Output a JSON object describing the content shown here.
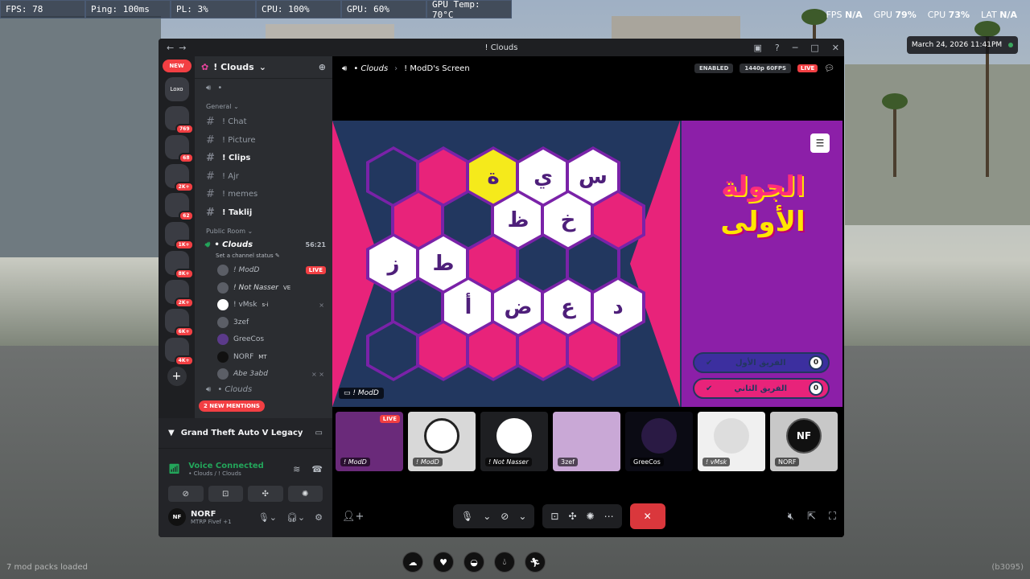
{
  "perf": [
    {
      "label": "FPS: 78"
    },
    {
      "label": "Ping: 100ms"
    },
    {
      "label": "PL: 3%"
    },
    {
      "label": "CPU: 100%"
    },
    {
      "label": "GPU: 60%"
    },
    {
      "label": "GPU Temp: 70°C"
    }
  ],
  "hud": {
    "fps_label": "FPS",
    "fps_value": "N/A",
    "gpu_label": "GPU",
    "gpu_value": "79",
    "cpu_label": "CPU",
    "cpu_value": "73",
    "lat_label": "LAT",
    "lat_value": "N/A",
    "clock": "March 24, 2026 11:41PM"
  },
  "window": {
    "title": "! Clouds"
  },
  "rail": {
    "new_label": "NEW",
    "servers": [
      {
        "label": "Loxo",
        "badge": ""
      },
      {
        "label": "",
        "badge": "769"
      },
      {
        "label": "",
        "badge": "68"
      },
      {
        "label": "",
        "badge": "2K+"
      },
      {
        "label": "",
        "badge": "62"
      },
      {
        "label": "",
        "badge": "1K+"
      },
      {
        "label": "",
        "badge": "8K+"
      },
      {
        "label": "",
        "badge": "2K+"
      },
      {
        "label": "",
        "badge": "6K+"
      },
      {
        "label": "",
        "badge": "4K+"
      }
    ]
  },
  "guild": {
    "name": "! Clouds",
    "top_channel": "•",
    "categories": {
      "general": "General",
      "public": "Public Room"
    },
    "text_channels": [
      {
        "name": "! Chat",
        "bright": false
      },
      {
        "name": "! Picture",
        "bright": false
      },
      {
        "name": "! Clips",
        "bright": true
      },
      {
        "name": "! Ajr",
        "bright": false
      },
      {
        "name": "! memes",
        "bright": false
      },
      {
        "name": "! Taklij",
        "bright": true
      }
    ],
    "voice_channel": {
      "name": "• Clouds",
      "time": "56:21",
      "status": "Set a channel status"
    },
    "voice_users": [
      {
        "name": "! ModD",
        "tag": "",
        "live": "LIVE"
      },
      {
        "name": "! Not Nasser",
        "tag": "VE",
        "live": ""
      },
      {
        "name": "! vMsk",
        "tag": "s-i",
        "live": ""
      },
      {
        "name": "3zef",
        "tag": "",
        "live": ""
      },
      {
        "name": "GreeCos",
        "tag": "",
        "live": ""
      },
      {
        "name": "NORF",
        "tag": "MT",
        "live": ""
      },
      {
        "name": "Abe 3abd",
        "tag": "",
        "live": ""
      }
    ],
    "next_voice": "• Clouds",
    "mentions": "2 NEW MENTIONS"
  },
  "activity": {
    "game": "Grand Theft Auto V Legacy"
  },
  "voice": {
    "status": "Voice Connected",
    "channel": "• Clouds / ! Clouds"
  },
  "me": {
    "name": "NORF",
    "avatar": "NF",
    "sub": "MTRP Fivef +1"
  },
  "stage": {
    "channel": "• Clouds",
    "screen_title": "! ModD's Screen",
    "enabled": "ENABLED",
    "quality": "1440p 60FPS",
    "live": "LIVE",
    "streamer_tag": "! ModD"
  },
  "game_board": {
    "round_line1": "الجولة",
    "round_line2": "الأولى",
    "team1_name": "الفريق الأول",
    "team1_score": "0",
    "team2_name": "الفريق الثاني",
    "team2_score": "0",
    "letters": [
      "ة",
      "ي",
      "س",
      "ظ",
      "خ",
      "ز",
      "ط",
      "أ",
      "ض",
      "ع",
      "د"
    ]
  },
  "tiles": [
    {
      "name": "! ModD",
      "live": "LIVE"
    },
    {
      "name": "! ModD",
      "live": ""
    },
    {
      "name": "! Not Nasser",
      "live": ""
    },
    {
      "name": "3zef",
      "live": ""
    },
    {
      "name": "GreeCos",
      "live": ""
    },
    {
      "name": "! vMsk",
      "live": ""
    },
    {
      "name": "NORF",
      "live": "",
      "avatar": "NF"
    }
  ],
  "footer": {
    "modpacks": "7 mod packs loaded",
    "build": "(b3095)"
  }
}
